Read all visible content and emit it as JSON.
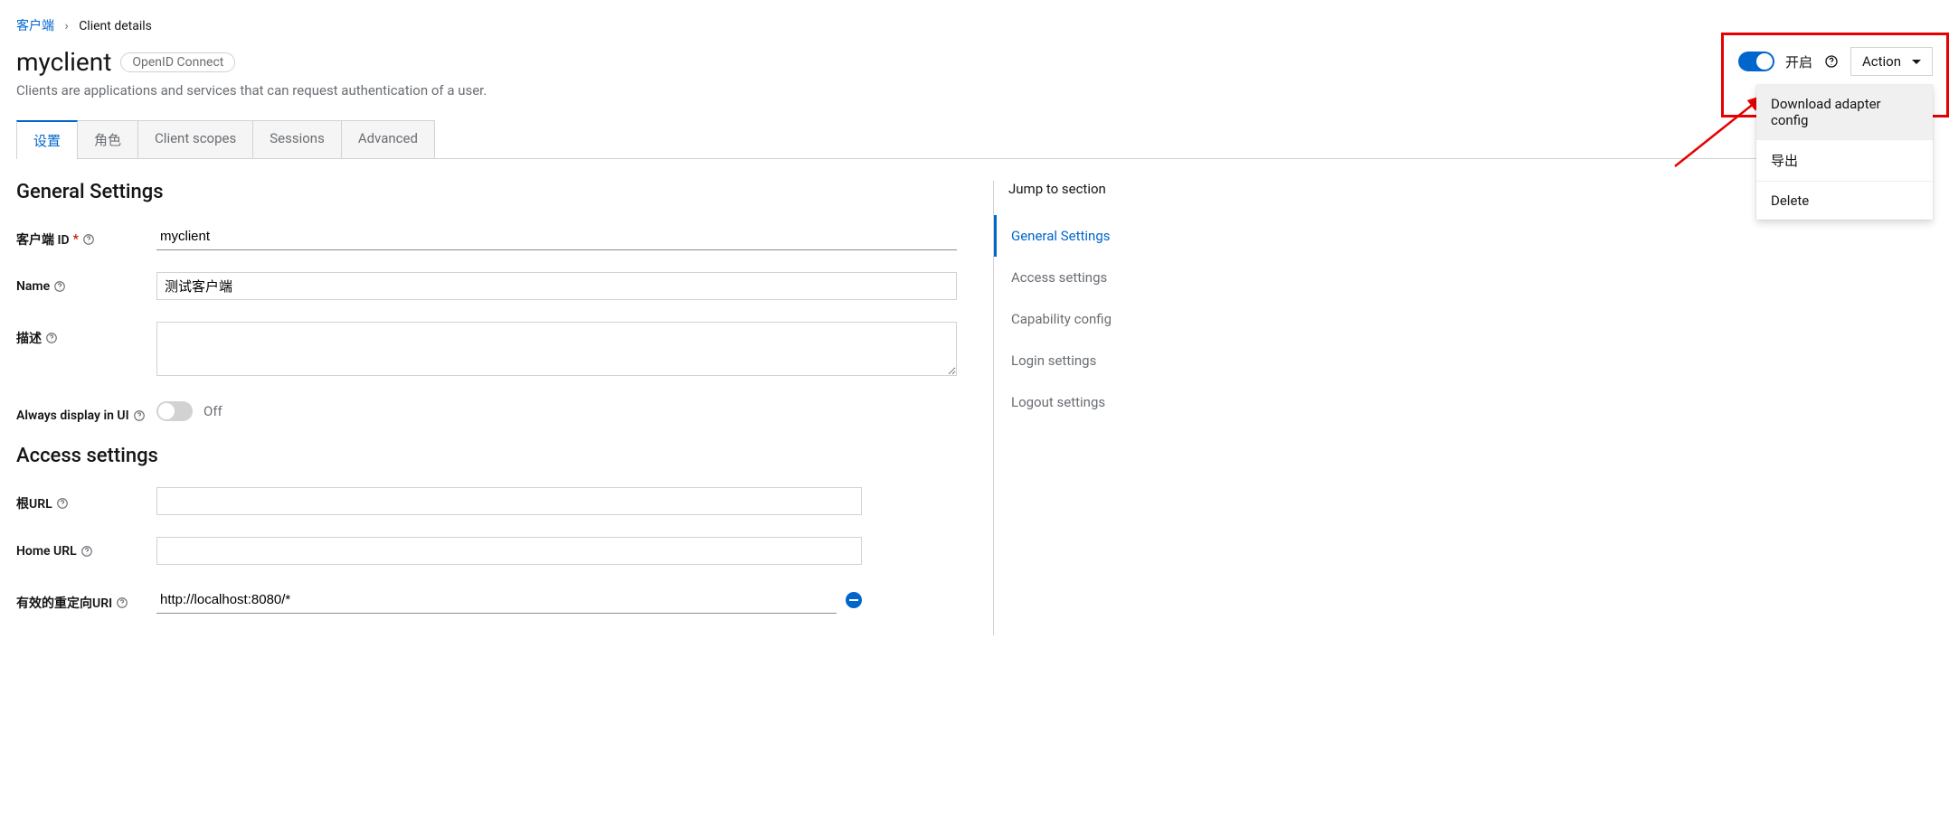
{
  "breadcrumb": {
    "root": "客户端",
    "current": "Client details"
  },
  "header": {
    "title": "myclient",
    "pill": "OpenID Connect",
    "subtitle": "Clients are applications and services that can request authentication of a user.",
    "toggle_label": "开启",
    "action_label": "Action"
  },
  "dropdown": {
    "download": "Download adapter config",
    "export": "导出",
    "delete": "Delete"
  },
  "tabs": {
    "settings": "设置",
    "roles": "角色",
    "client_scopes": "Client scopes",
    "sessions": "Sessions",
    "advanced": "Advanced"
  },
  "sections": {
    "general": "General Settings",
    "access": "Access settings"
  },
  "labels": {
    "client_id": "客户端 ID",
    "name": "Name",
    "description": "描述",
    "always_display": "Always display in UI",
    "root_url": "根URL",
    "home_url": "Home URL",
    "valid_redirect": "有效的重定向URI",
    "off": "Off"
  },
  "values": {
    "client_id": "myclient",
    "name": "测试客户端",
    "description": "",
    "root_url": "",
    "home_url": "",
    "redirect_uri": "http://localhost:8080/*"
  },
  "sidenav": {
    "title": "Jump to section",
    "general": "General Settings",
    "access": "Access settings",
    "capability": "Capability config",
    "login": "Login settings",
    "logout": "Logout settings"
  }
}
